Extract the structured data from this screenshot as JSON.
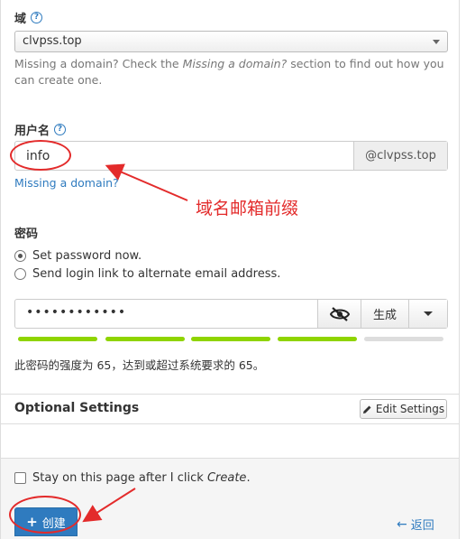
{
  "domain": {
    "label": "域",
    "selected": "clvpss.top",
    "hint_prefix": "Missing a domain? Check the ",
    "hint_em": "Missing a domain?",
    "hint_suffix": " section to find out how you can create one."
  },
  "username": {
    "label": "用户名",
    "value": "info",
    "suffix": "@clvpss.top",
    "missing_link": "Missing a domain?"
  },
  "annotation": {
    "text": "域名邮箱前缀",
    "color": "#e32b2b"
  },
  "password": {
    "label": "密码",
    "options": [
      {
        "label": "Set password now.",
        "selected": true
      },
      {
        "label": "Send login link to alternate email address.",
        "selected": false
      }
    ],
    "value": "••••••••••••",
    "visibility_icon": "eye-slash-icon",
    "generate_label": "生成",
    "strength_text": "此密码的强度为 65，达到或超过系统要求的 65。",
    "strength_segments": [
      {
        "filled": true
      },
      {
        "filled": true
      },
      {
        "filled": true
      },
      {
        "filled": true
      },
      {
        "filled": false
      }
    ],
    "meter_color": "#8fd400"
  },
  "optional": {
    "title": "Optional Settings",
    "edit_label": "Edit Settings"
  },
  "footer": {
    "stay_prefix": "Stay on this page after I click ",
    "stay_em": "Create",
    "stay_suffix": ".",
    "create_label": "创建",
    "back_label": "返回"
  },
  "colors": {
    "accent": "#2f7bbf",
    "annotation": "#e32b2b"
  }
}
